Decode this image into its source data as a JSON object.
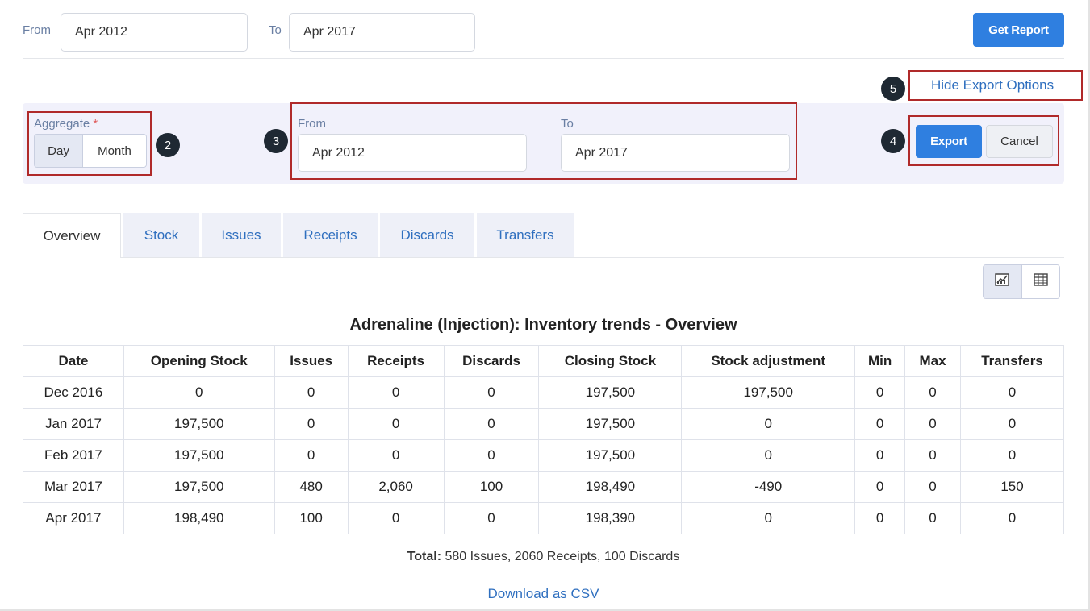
{
  "top_filters": {
    "from_label": "From",
    "from_value": "Apr 2012",
    "to_label": "To",
    "to_value": "Apr 2017",
    "get_report_label": "Get Report"
  },
  "export_toggle_label": "Hide Export Options",
  "export_panel": {
    "aggregate_label": "Aggregate",
    "required_mark": "*",
    "aggregate_options": [
      "Day",
      "Month"
    ],
    "aggregate_selected": "Day",
    "from_label": "From",
    "from_value": "Apr 2012",
    "to_label": "To",
    "to_value": "Apr 2017",
    "export_label": "Export",
    "cancel_label": "Cancel"
  },
  "callouts": [
    "2",
    "3",
    "4",
    "5"
  ],
  "tabs": [
    "Overview",
    "Stock",
    "Issues",
    "Receipts",
    "Discards",
    "Transfers"
  ],
  "active_tab": "Overview",
  "view_toggle": {
    "icons": [
      "chart-icon",
      "table-icon"
    ]
  },
  "report_title": "Adrenaline (Injection): Inventory trends - Overview",
  "table": {
    "columns": [
      "Date",
      "Opening Stock",
      "Issues",
      "Receipts",
      "Discards",
      "Closing Stock",
      "Stock adjustment",
      "Min",
      "Max",
      "Transfers"
    ],
    "rows": [
      [
        "Dec 2016",
        "0",
        "0",
        "0",
        "0",
        "197,500",
        "197,500",
        "0",
        "0",
        "0"
      ],
      [
        "Jan 2017",
        "197,500",
        "0",
        "0",
        "0",
        "197,500",
        "0",
        "0",
        "0",
        "0"
      ],
      [
        "Feb 2017",
        "197,500",
        "0",
        "0",
        "0",
        "197,500",
        "0",
        "0",
        "0",
        "0"
      ],
      [
        "Mar 2017",
        "197,500",
        "480",
        "2,060",
        "100",
        "198,490",
        "-490",
        "0",
        "0",
        "150"
      ],
      [
        "Apr 2017",
        "198,490",
        "100",
        "0",
        "0",
        "198,390",
        "0",
        "0",
        "0",
        "0"
      ]
    ]
  },
  "total": {
    "label": "Total:",
    "text": "580 Issues, 2060 Receipts, 100 Discards"
  },
  "download_csv_label": "Download as CSV",
  "colors": {
    "primary": "#2f7fe0",
    "link": "#2f6fbf",
    "callout_border": "#b02a2a",
    "panel_bg": "#f1f1fb"
  }
}
